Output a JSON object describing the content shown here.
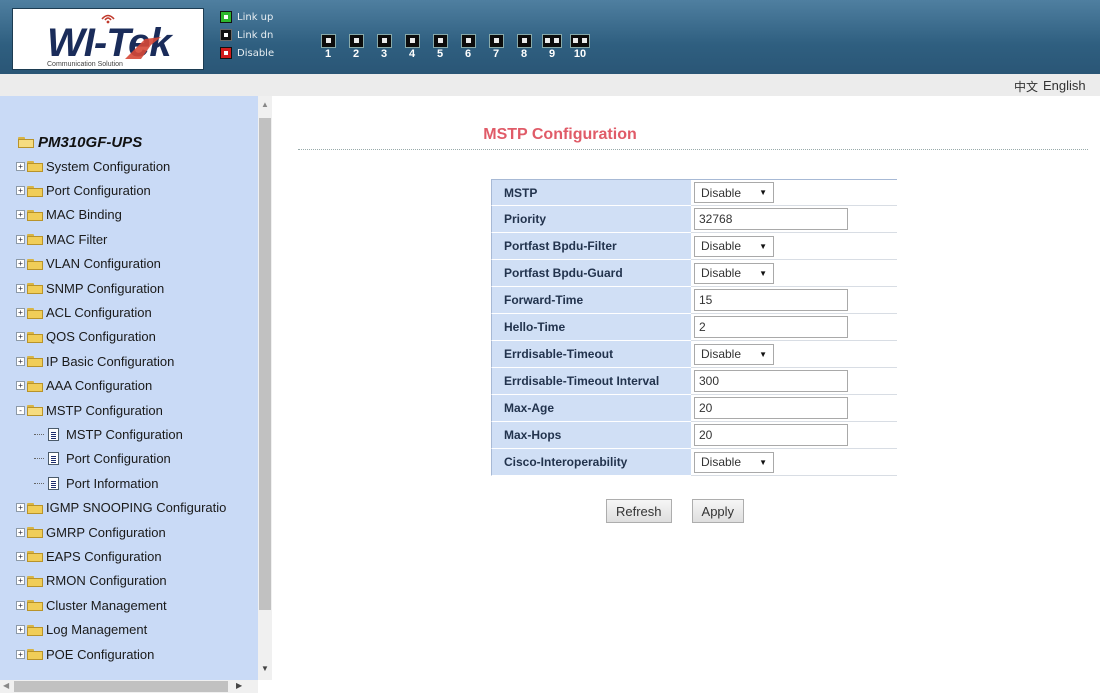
{
  "header": {
    "logo_text": "WI-Tek",
    "logo_subtitle": "Communication Solution",
    "legend": [
      {
        "label": "Link up",
        "state": "up"
      },
      {
        "label": "Link dn",
        "state": "dn"
      },
      {
        "label": "Disable",
        "state": "dis"
      }
    ],
    "ports": [
      "1",
      "2",
      "3",
      "4",
      "5",
      "6",
      "7",
      "8",
      "9",
      "10"
    ]
  },
  "language": {
    "chinese": "中文",
    "english": "English"
  },
  "sidebar": {
    "root": "PM310GF-UPS",
    "items": [
      {
        "label": "System Configuration"
      },
      {
        "label": "Port Configuration"
      },
      {
        "label": "MAC Binding"
      },
      {
        "label": "MAC Filter"
      },
      {
        "label": "VLAN Configuration"
      },
      {
        "label": "SNMP Configuration"
      },
      {
        "label": "ACL Configuration"
      },
      {
        "label": "QOS Configuration"
      },
      {
        "label": "IP Basic Configuration"
      },
      {
        "label": "AAA Configuration"
      },
      {
        "label": "MSTP Configuration",
        "expanded": true,
        "children": [
          "MSTP Configuration",
          "Port Configuration",
          "Port Information"
        ]
      },
      {
        "label": "IGMP SNOOPING Configuratio"
      },
      {
        "label": "GMRP Configuration"
      },
      {
        "label": "EAPS Configuration"
      },
      {
        "label": "RMON Configuration"
      },
      {
        "label": "Cluster Management"
      },
      {
        "label": "Log Management"
      },
      {
        "label": "POE Configuration"
      }
    ]
  },
  "main": {
    "title": "MSTP Configuration",
    "fields": [
      {
        "label": "MSTP",
        "type": "select",
        "value": "Disable"
      },
      {
        "label": "Priority",
        "type": "input",
        "value": "32768"
      },
      {
        "label": "Portfast Bpdu-Filter",
        "type": "select",
        "value": "Disable"
      },
      {
        "label": "Portfast Bpdu-Guard",
        "type": "select",
        "value": "Disable"
      },
      {
        "label": "Forward-Time",
        "type": "input",
        "value": "15"
      },
      {
        "label": "Hello-Time",
        "type": "input",
        "value": "2"
      },
      {
        "label": "Errdisable-Timeout",
        "type": "select",
        "value": "Disable"
      },
      {
        "label": "Errdisable-Timeout Interval",
        "type": "input",
        "value": "300"
      },
      {
        "label": "Max-Age",
        "type": "input",
        "value": "20"
      },
      {
        "label": "Max-Hops",
        "type": "input",
        "value": "20"
      },
      {
        "label": "Cisco-Interoperability",
        "type": "select",
        "value": "Disable"
      }
    ],
    "buttons": {
      "refresh": "Refresh",
      "apply": "Apply"
    }
  },
  "colors": {
    "header_bg": "#2f5f80",
    "sidebar_bg": "#c9daf6",
    "title_color": "#e05b68",
    "label_cell_bg": "#d0dff5"
  }
}
